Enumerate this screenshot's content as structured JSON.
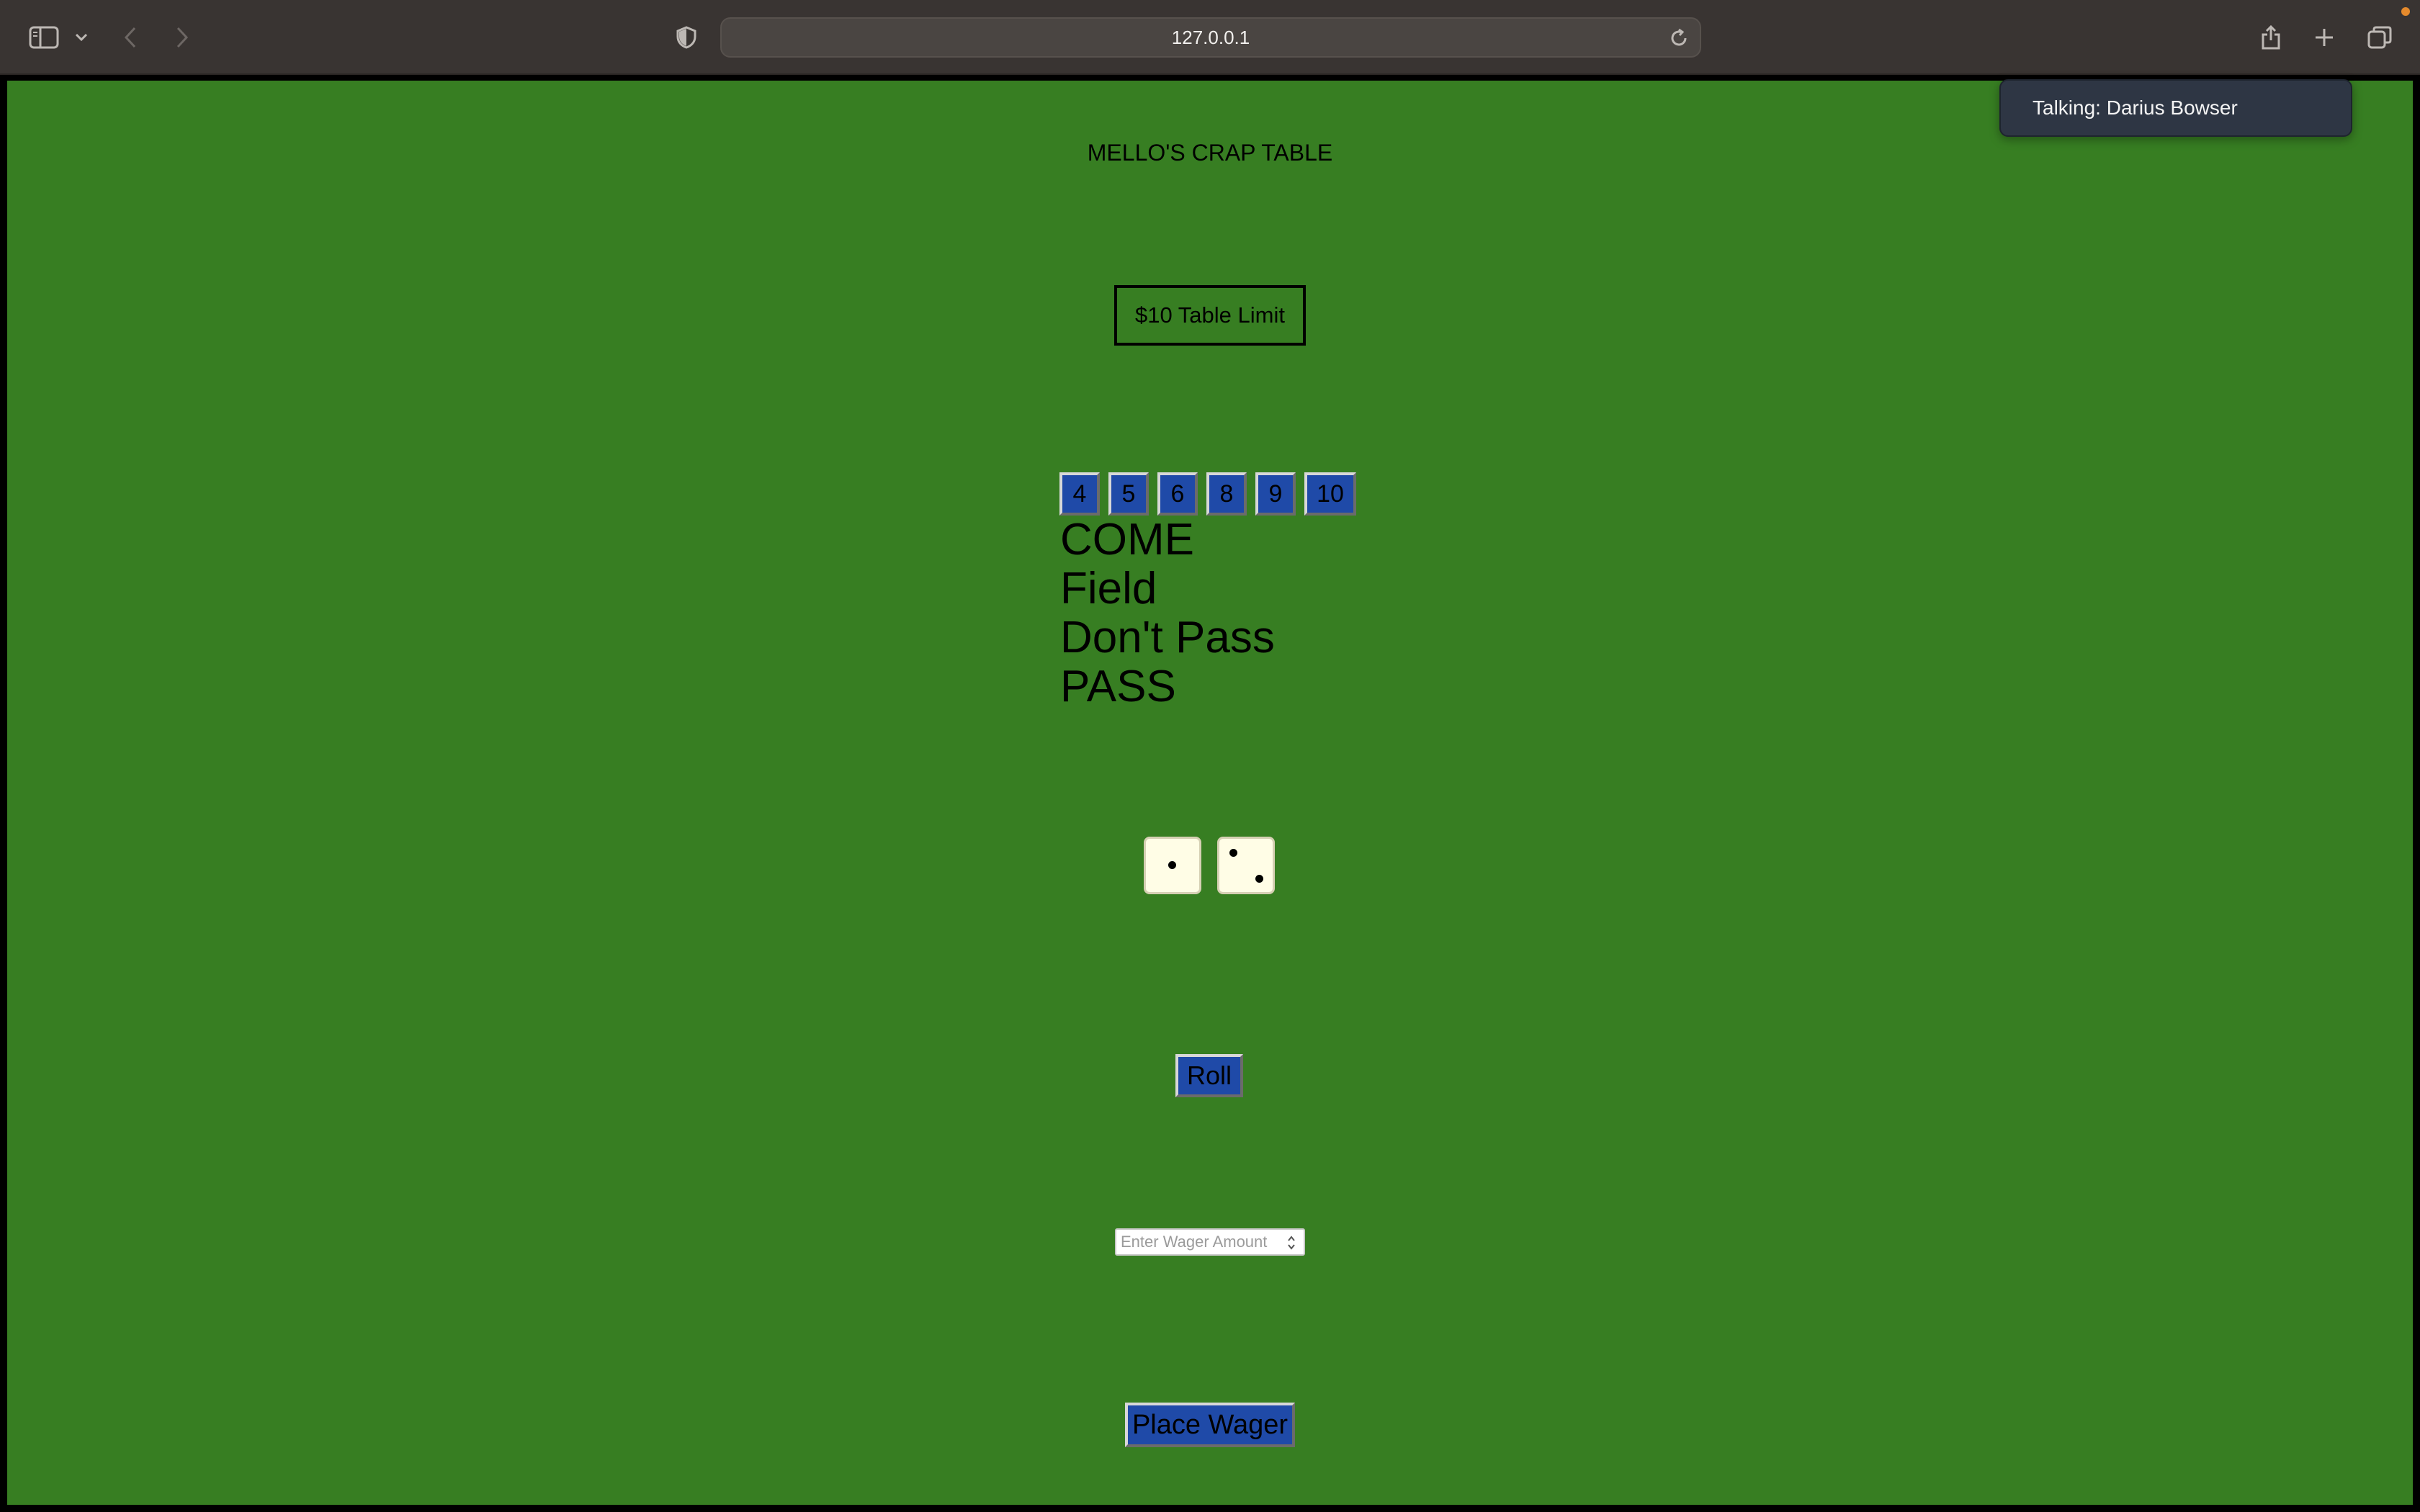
{
  "browser": {
    "url": "127.0.0.1"
  },
  "notification": {
    "text": "Talking: Darius Bowser"
  },
  "page": {
    "title": "MELLO'S CRAP TABLE",
    "table_limit": "$10 Table Limit",
    "numbers": [
      "4",
      "5",
      "6",
      "8",
      "9",
      "10"
    ],
    "bets": [
      "COME",
      "Field",
      "Don't Pass",
      "PASS"
    ],
    "dice": [
      1,
      2
    ],
    "roll_label": "Roll",
    "wager_placeholder": "Enter Wager Amount",
    "place_wager_label": "Place Wager"
  },
  "colors": {
    "table_felt": "#377e22",
    "button_blue": "#1f4aa8",
    "die_face": "#fffde6"
  }
}
